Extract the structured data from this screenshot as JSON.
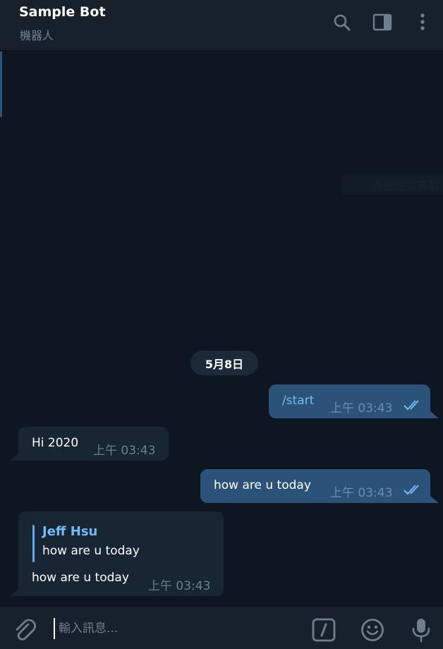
{
  "header": {
    "title": "Sample Bot",
    "subtitle": "機器人",
    "search_icon": "search-icon",
    "sidebar_icon": "sidebar-toggle-icon",
    "menu_icon": "more-vertical-icon"
  },
  "messages": {
    "ghost_text": "点击这里获取",
    "date": "5月8日",
    "items": [
      {
        "direction": "out",
        "text": "/start",
        "time": "上午 03:43",
        "status": "read"
      },
      {
        "direction": "in",
        "text": "Hi 2020",
        "time": "上午 03:43"
      },
      {
        "direction": "out",
        "text": "how are u today",
        "time": "上午 03:43",
        "status": "read"
      },
      {
        "direction": "in",
        "reply_name": "Jeff Hsu",
        "reply_text": "how are u today",
        "text": "how are u today",
        "time": "上午 03:43"
      }
    ]
  },
  "composer": {
    "placeholder": "輸入訊息...",
    "attach_icon": "paperclip-icon",
    "commands_icon": "bot-commands-icon",
    "emoji_icon": "emoji-icon",
    "mic_icon": "microphone-icon"
  },
  "colors": {
    "background": "#0e1621",
    "header": "#17212b",
    "outgoing_bubble": "#2b5278",
    "incoming_bubble": "#182533",
    "accent": "#71bcf7"
  }
}
